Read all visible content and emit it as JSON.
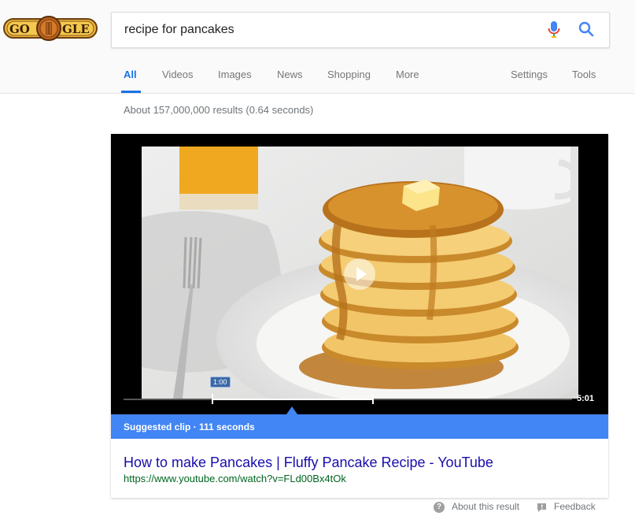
{
  "logo": {
    "left": "GO",
    "right": "GLE"
  },
  "search": {
    "query": "recipe for pancakes"
  },
  "tabs": [
    {
      "label": "All"
    },
    {
      "label": "Videos"
    },
    {
      "label": "Images"
    },
    {
      "label": "News"
    },
    {
      "label": "Shopping"
    },
    {
      "label": "More"
    }
  ],
  "tools": {
    "settings": "Settings",
    "tools": "Tools"
  },
  "stats": "About 157,000,000 results (0.64 seconds)",
  "video": {
    "marker_time": "1:00",
    "duration": "5:01",
    "clip_label": "Suggested clip · 111 seconds"
  },
  "result": {
    "title": "How to make Pancakes | Fluffy Pancake Recipe - YouTube",
    "url": "https://www.youtube.com/watch?v=FLd00Bx4tOk"
  },
  "footer": {
    "about": "About this result",
    "feedback": "Feedback"
  },
  "colors": {
    "accent": "#1a73e8",
    "clip_bar": "#4285f4",
    "link": "#1a0dab",
    "url": "#006621"
  }
}
